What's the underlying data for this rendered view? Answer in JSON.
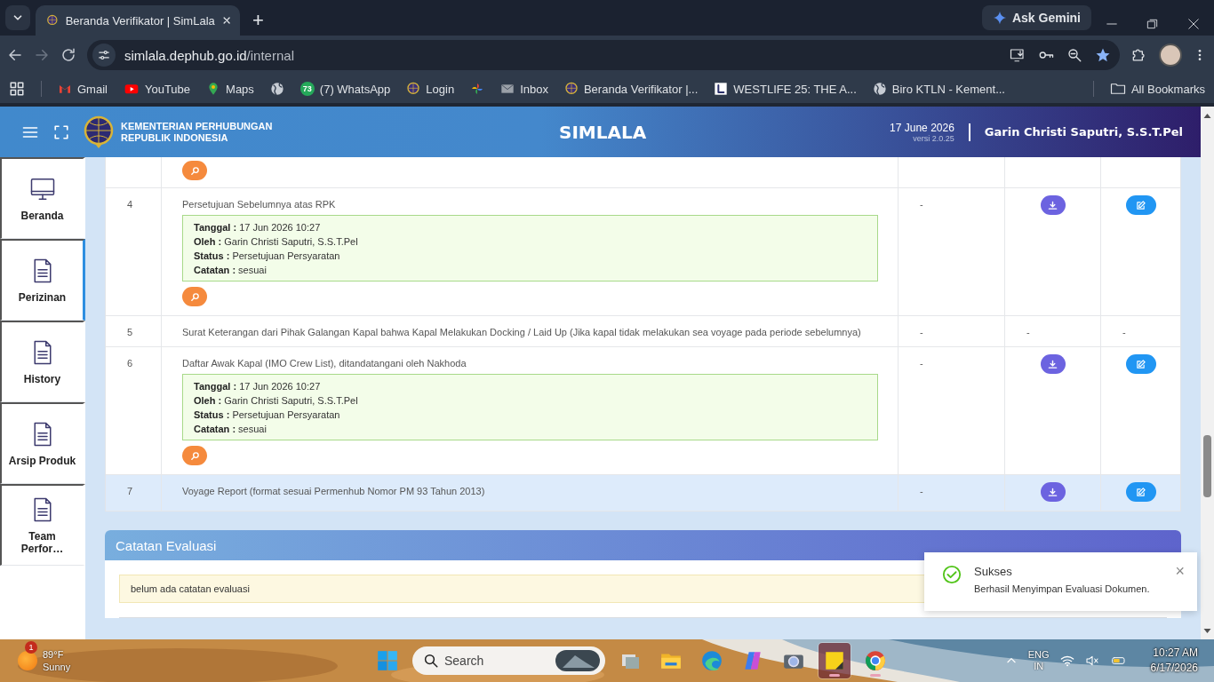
{
  "browser": {
    "tabs": [
      {
        "title": "Beranda Verifikator | SimLala",
        "selected": true
      }
    ],
    "new_tab": "+",
    "ask_gemini": "Ask Gemini",
    "nav": [
      {
        "kind": "back",
        "disabled": false
      },
      {
        "kind": "forward",
        "disabled": true
      },
      {
        "kind": "reload",
        "disabled": false
      }
    ],
    "address": {
      "host": "simlala.dephub.go.id",
      "path": "/internal"
    },
    "bookmarks": [
      {
        "kind": "gmail",
        "label": "Gmail"
      },
      {
        "kind": "youtube",
        "label": "YouTube"
      },
      {
        "kind": "maps",
        "label": "Maps"
      },
      {
        "kind": "globe"
      },
      {
        "kind": "whatsapp",
        "badge": "73",
        "label": "(7) WhatsApp"
      },
      {
        "kind": "emblem",
        "label": "Login"
      },
      {
        "kind": "photos"
      },
      {
        "kind": "mail",
        "label": "Inbox"
      },
      {
        "kind": "emblem",
        "label": "Beranda Verifikator |..."
      },
      {
        "kind": "square",
        "label": "WESTLIFE 25: THE A..."
      },
      {
        "kind": "globe",
        "label": "Biro KTLN - Kement..."
      }
    ],
    "all_bookmarks": "All Bookmarks"
  },
  "header": {
    "org": [
      "KEMENTERIAN PERHUBUNGAN",
      "REPUBLIK INDONESIA"
    ],
    "title": "SIMLALA",
    "date": "17 June 2026",
    "version": "versi 2.0.25",
    "user": "Garin Christi Saputri, S.S.T.Pel"
  },
  "sidebar": {
    "items": [
      {
        "kind": "monitor",
        "label": "Beranda",
        "selected": false
      },
      {
        "kind": "document",
        "label": "Perizinan",
        "selected": true
      },
      {
        "kind": "document",
        "label": "History",
        "selected": false
      },
      {
        "kind": "document",
        "label": "Arsip Produk",
        "selected": false
      },
      {
        "kind": "document",
        "label": "Team Perfor…",
        "selected": false
      }
    ]
  },
  "table": {
    "rows": [
      {
        "search": true,
        "highlighted": false,
        "cells": []
      },
      {
        "no": "4",
        "document": "Persetujuan Sebelumnya atas RPK",
        "approval": [
          "**Tanggal :** 17 Jun 2026 10:27",
          "**Oleh :** Garin Christi Saputri, S.S.T.Pel",
          "**Status :** Persetujuan Persyaratan",
          "**Catatan :** sesuai"
        ],
        "search": true,
        "highlighted": false,
        "cells": [
          {
            "kind": "text",
            "text": "-"
          },
          {
            "kind": "download"
          },
          {
            "kind": "edit"
          }
        ]
      },
      {
        "no": "5",
        "document": "Surat Keterangan dari Pihak Galangan Kapal bahwa Kapal Melakukan Docking / Laid Up (Jika kapal tidak melakukan sea voyage pada periode sebelumnya)",
        "search": false,
        "highlighted": false,
        "cells": [
          {
            "kind": "text",
            "text": "-"
          },
          {
            "kind": "text",
            "text": "-"
          },
          {
            "kind": "text",
            "text": "-"
          }
        ]
      },
      {
        "no": "6",
        "document": "Daftar Awak Kapal (IMO Crew List), ditandatangani oleh Nakhoda",
        "approval": [
          "**Tanggal :** 17 Jun 2026 10:27",
          "**Oleh :** Garin Christi Saputri, S.S.T.Pel",
          "**Status :** Persetujuan Persyaratan",
          "**Catatan :** sesuai"
        ],
        "search": true,
        "highlighted": false,
        "cells": [
          {
            "kind": "text",
            "text": "-"
          },
          {
            "kind": "download"
          },
          {
            "kind": "edit"
          }
        ]
      },
      {
        "no": "7",
        "document": "Voyage Report (format sesuai Permenhub Nomor PM 93 Tahun 2013)",
        "search": false,
        "highlighted": true,
        "cells": [
          {
            "kind": "text",
            "text": "-"
          },
          {
            "kind": "download"
          },
          {
            "kind": "edit"
          }
        ]
      }
    ]
  },
  "evaluation": {
    "title": "Catatan Evaluasi",
    "note": "belum ada catatan evaluasi"
  },
  "toast": {
    "title": "Sukses",
    "message": "Berhasil Menyimpan Evaluasi Dokumen.",
    "close": "×"
  },
  "taskbar": {
    "weather": {
      "badge": "1",
      "temp": "89°F",
      "condition": "Sunny"
    },
    "search": {
      "placeholder": "Search"
    },
    "apps": [
      {
        "kind": "start",
        "selected": false,
        "running": false
      },
      {
        "kind": "task-view",
        "selected": false,
        "running": false
      },
      {
        "kind": "folder",
        "selected": false,
        "running": false
      },
      {
        "kind": "edge",
        "selected": false,
        "running": false
      },
      {
        "kind": "copilot",
        "selected": false,
        "running": false
      },
      {
        "kind": "camera",
        "selected": false,
        "running": false
      },
      {
        "kind": "notes",
        "selected": true,
        "running": true
      },
      {
        "kind": "chrome",
        "selected": false,
        "running": true
      }
    ],
    "language": [
      "ENG",
      "IN"
    ],
    "time": "10:27 AM",
    "date": "6/17/2026"
  }
}
